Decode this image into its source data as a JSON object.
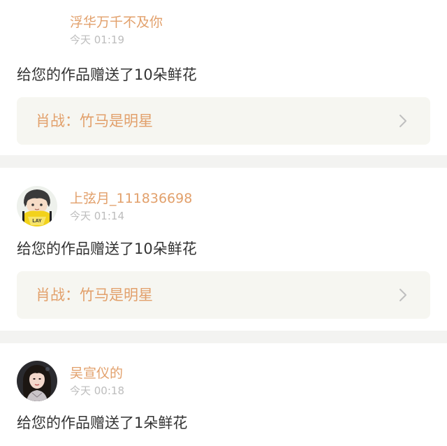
{
  "feed": {
    "items": [
      {
        "username": "浮华万千不及你",
        "time": "今天 01:19",
        "message": "给您的作品赠送了10朵鲜花",
        "work_title": "肖战：竹马是明星",
        "avatar": "none"
      },
      {
        "username": "上弦月_111836698",
        "time": "今天 01:14",
        "message": "给您的作品赠送了10朵鲜花",
        "work_title": "肖战：竹马是明星",
        "avatar": "cartoon-boy-lay-avatar",
        "avatar_badge": "LAY"
      },
      {
        "username": "吴宣仪的",
        "time": "今天 00:18",
        "message": "给您的作品赠送了1朵鲜花",
        "avatar": "girl-photo-avatar"
      }
    ]
  },
  "colors": {
    "accent": "#e2a06b",
    "text": "#333333",
    "muted": "#bdbdbd",
    "box_bg": "#f6f6f1",
    "divider": "#f3f3f1"
  },
  "icons": {
    "chevron": "chevron-right-icon"
  }
}
